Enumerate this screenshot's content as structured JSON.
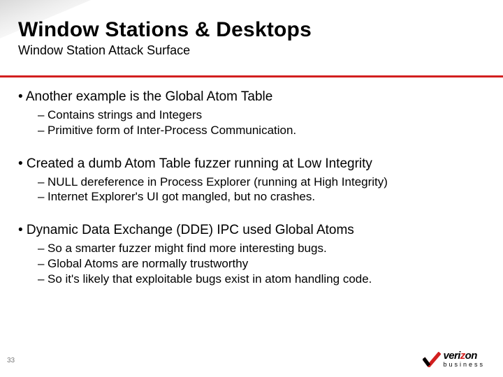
{
  "header": {
    "title": "Window Stations & Desktops",
    "subtitle": "Window Station Attack Surface"
  },
  "bullets": [
    {
      "main": "• Another example is the Global Atom Table",
      "subs": [
        "Contains strings and Integers",
        "Primitive form of Inter-Process Communication."
      ]
    },
    {
      "main": "• Created a dumb Atom Table fuzzer running at Low Integrity",
      "subs": [
        "NULL dereference in Process Explorer (running at High Integrity)",
        "Internet Explorer's UI got mangled, but no crashes."
      ]
    },
    {
      "main": "•  Dynamic Data Exchange (DDE) IPC used Global Atoms",
      "subs": [
        "So a smarter fuzzer might find more interesting bugs.",
        "Global Atoms are normally trustworthy",
        "So it's likely that exploitable bugs exist in atom handling code."
      ]
    }
  ],
  "page_number": "33",
  "logo": {
    "brand": "verizon",
    "sub": "business",
    "colors": {
      "red": "#d21f1f",
      "black": "#000000"
    }
  }
}
